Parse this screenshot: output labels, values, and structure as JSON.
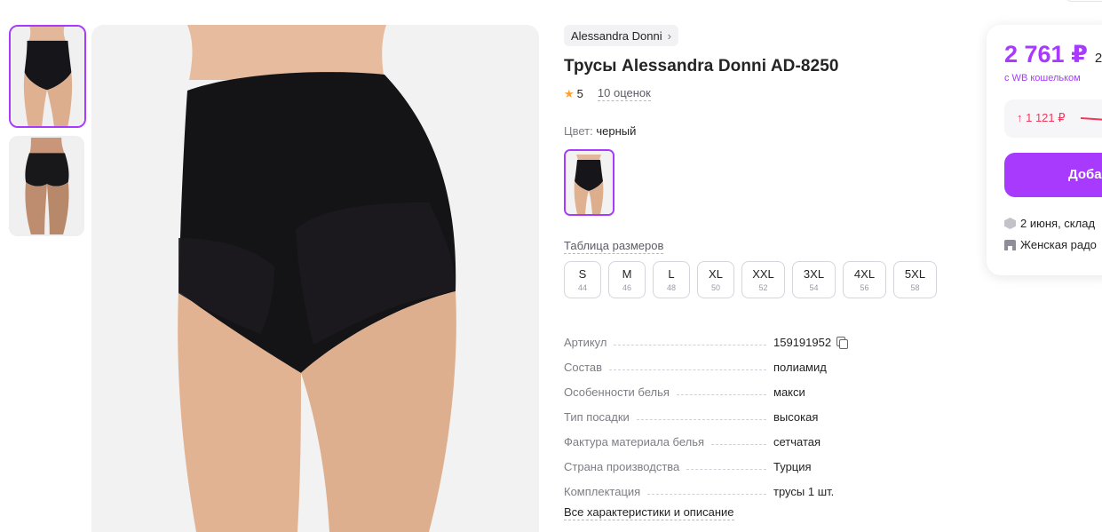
{
  "product": {
    "brand": "Alessandra Donni",
    "title": "Трусы Alessandra Donni AD-8250",
    "rating": "5",
    "reviews": "10 оценок",
    "color_label": "Цвет:",
    "color_value": "черный",
    "size_table_link": "Таблица размеров",
    "sizes": [
      {
        "size": "S",
        "ru": "44"
      },
      {
        "size": "M",
        "ru": "46"
      },
      {
        "size": "L",
        "ru": "48"
      },
      {
        "size": "XL",
        "ru": "50"
      },
      {
        "size": "XXL",
        "ru": "52"
      },
      {
        "size": "3XL",
        "ru": "54"
      },
      {
        "size": "4XL",
        "ru": "56"
      },
      {
        "size": "5XL",
        "ru": "58"
      }
    ],
    "specs": [
      {
        "key": "Артикул",
        "value": "159191952"
      },
      {
        "key": "Состав",
        "value": "полиамид"
      },
      {
        "key": "Особенности белья",
        "value": "макси"
      },
      {
        "key": "Тип посадки",
        "value": "высокая"
      },
      {
        "key": "Фактура материала белья",
        "value": "сетчатая"
      },
      {
        "key": "Страна производства",
        "value": "Турция"
      },
      {
        "key": "Комплектация",
        "value": "трусы 1 шт."
      }
    ],
    "all_characteristics_link": "Все характеристики и описание"
  },
  "price_card": {
    "price": "2 761 ₽",
    "old_price": "2",
    "wallet_note": "с WB кошельком",
    "price_change": "↑ 1 121 ₽",
    "add_button": "Доба",
    "delivery": "2 июня, склад",
    "warehouse": "Женская радо"
  },
  "colors": {
    "accent": "#a73afd",
    "star": "#ff9f2c",
    "price_up": "#f5365c"
  },
  "icons": {
    "star": "star-icon",
    "chevron": "chevron-right-icon",
    "copy": "copy-icon",
    "box": "box-icon",
    "store": "store-icon"
  }
}
